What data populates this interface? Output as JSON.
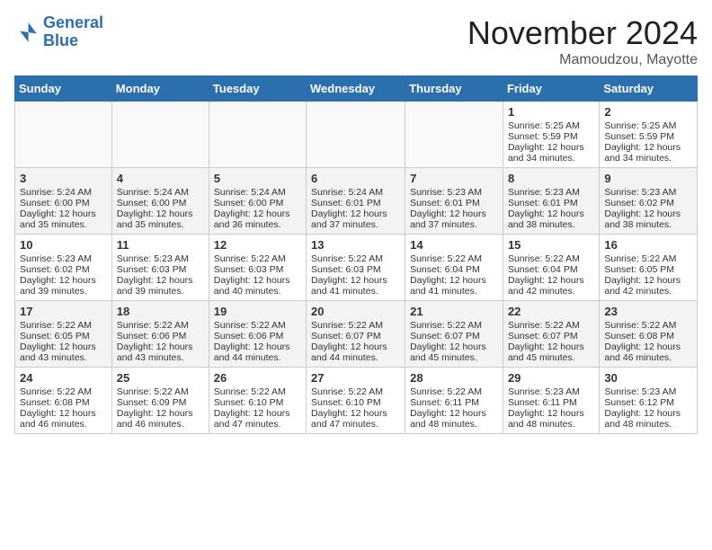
{
  "header": {
    "logo_line1": "General",
    "logo_line2": "Blue",
    "month_year": "November 2024",
    "location": "Mamoudzou, Mayotte"
  },
  "weekdays": [
    "Sunday",
    "Monday",
    "Tuesday",
    "Wednesday",
    "Thursday",
    "Friday",
    "Saturday"
  ],
  "weeks": [
    [
      {
        "day": "",
        "info": ""
      },
      {
        "day": "",
        "info": ""
      },
      {
        "day": "",
        "info": ""
      },
      {
        "day": "",
        "info": ""
      },
      {
        "day": "",
        "info": ""
      },
      {
        "day": "1",
        "info": "Sunrise: 5:25 AM\nSunset: 5:59 PM\nDaylight: 12 hours and 34 minutes."
      },
      {
        "day": "2",
        "info": "Sunrise: 5:25 AM\nSunset: 5:59 PM\nDaylight: 12 hours and 34 minutes."
      }
    ],
    [
      {
        "day": "3",
        "info": "Sunrise: 5:24 AM\nSunset: 6:00 PM\nDaylight: 12 hours and 35 minutes."
      },
      {
        "day": "4",
        "info": "Sunrise: 5:24 AM\nSunset: 6:00 PM\nDaylight: 12 hours and 35 minutes."
      },
      {
        "day": "5",
        "info": "Sunrise: 5:24 AM\nSunset: 6:00 PM\nDaylight: 12 hours and 36 minutes."
      },
      {
        "day": "6",
        "info": "Sunrise: 5:24 AM\nSunset: 6:01 PM\nDaylight: 12 hours and 37 minutes."
      },
      {
        "day": "7",
        "info": "Sunrise: 5:23 AM\nSunset: 6:01 PM\nDaylight: 12 hours and 37 minutes."
      },
      {
        "day": "8",
        "info": "Sunrise: 5:23 AM\nSunset: 6:01 PM\nDaylight: 12 hours and 38 minutes."
      },
      {
        "day": "9",
        "info": "Sunrise: 5:23 AM\nSunset: 6:02 PM\nDaylight: 12 hours and 38 minutes."
      }
    ],
    [
      {
        "day": "10",
        "info": "Sunrise: 5:23 AM\nSunset: 6:02 PM\nDaylight: 12 hours and 39 minutes."
      },
      {
        "day": "11",
        "info": "Sunrise: 5:23 AM\nSunset: 6:03 PM\nDaylight: 12 hours and 39 minutes."
      },
      {
        "day": "12",
        "info": "Sunrise: 5:22 AM\nSunset: 6:03 PM\nDaylight: 12 hours and 40 minutes."
      },
      {
        "day": "13",
        "info": "Sunrise: 5:22 AM\nSunset: 6:03 PM\nDaylight: 12 hours and 41 minutes."
      },
      {
        "day": "14",
        "info": "Sunrise: 5:22 AM\nSunset: 6:04 PM\nDaylight: 12 hours and 41 minutes."
      },
      {
        "day": "15",
        "info": "Sunrise: 5:22 AM\nSunset: 6:04 PM\nDaylight: 12 hours and 42 minutes."
      },
      {
        "day": "16",
        "info": "Sunrise: 5:22 AM\nSunset: 6:05 PM\nDaylight: 12 hours and 42 minutes."
      }
    ],
    [
      {
        "day": "17",
        "info": "Sunrise: 5:22 AM\nSunset: 6:05 PM\nDaylight: 12 hours and 43 minutes."
      },
      {
        "day": "18",
        "info": "Sunrise: 5:22 AM\nSunset: 6:06 PM\nDaylight: 12 hours and 43 minutes."
      },
      {
        "day": "19",
        "info": "Sunrise: 5:22 AM\nSunset: 6:06 PM\nDaylight: 12 hours and 44 minutes."
      },
      {
        "day": "20",
        "info": "Sunrise: 5:22 AM\nSunset: 6:07 PM\nDaylight: 12 hours and 44 minutes."
      },
      {
        "day": "21",
        "info": "Sunrise: 5:22 AM\nSunset: 6:07 PM\nDaylight: 12 hours and 45 minutes."
      },
      {
        "day": "22",
        "info": "Sunrise: 5:22 AM\nSunset: 6:07 PM\nDaylight: 12 hours and 45 minutes."
      },
      {
        "day": "23",
        "info": "Sunrise: 5:22 AM\nSunset: 6:08 PM\nDaylight: 12 hours and 46 minutes."
      }
    ],
    [
      {
        "day": "24",
        "info": "Sunrise: 5:22 AM\nSunset: 6:08 PM\nDaylight: 12 hours and 46 minutes."
      },
      {
        "day": "25",
        "info": "Sunrise: 5:22 AM\nSunset: 6:09 PM\nDaylight: 12 hours and 46 minutes."
      },
      {
        "day": "26",
        "info": "Sunrise: 5:22 AM\nSunset: 6:10 PM\nDaylight: 12 hours and 47 minutes."
      },
      {
        "day": "27",
        "info": "Sunrise: 5:22 AM\nSunset: 6:10 PM\nDaylight: 12 hours and 47 minutes."
      },
      {
        "day": "28",
        "info": "Sunrise: 5:22 AM\nSunset: 6:11 PM\nDaylight: 12 hours and 48 minutes."
      },
      {
        "day": "29",
        "info": "Sunrise: 5:23 AM\nSunset: 6:11 PM\nDaylight: 12 hours and 48 minutes."
      },
      {
        "day": "30",
        "info": "Sunrise: 5:23 AM\nSunset: 6:12 PM\nDaylight: 12 hours and 48 minutes."
      }
    ]
  ]
}
